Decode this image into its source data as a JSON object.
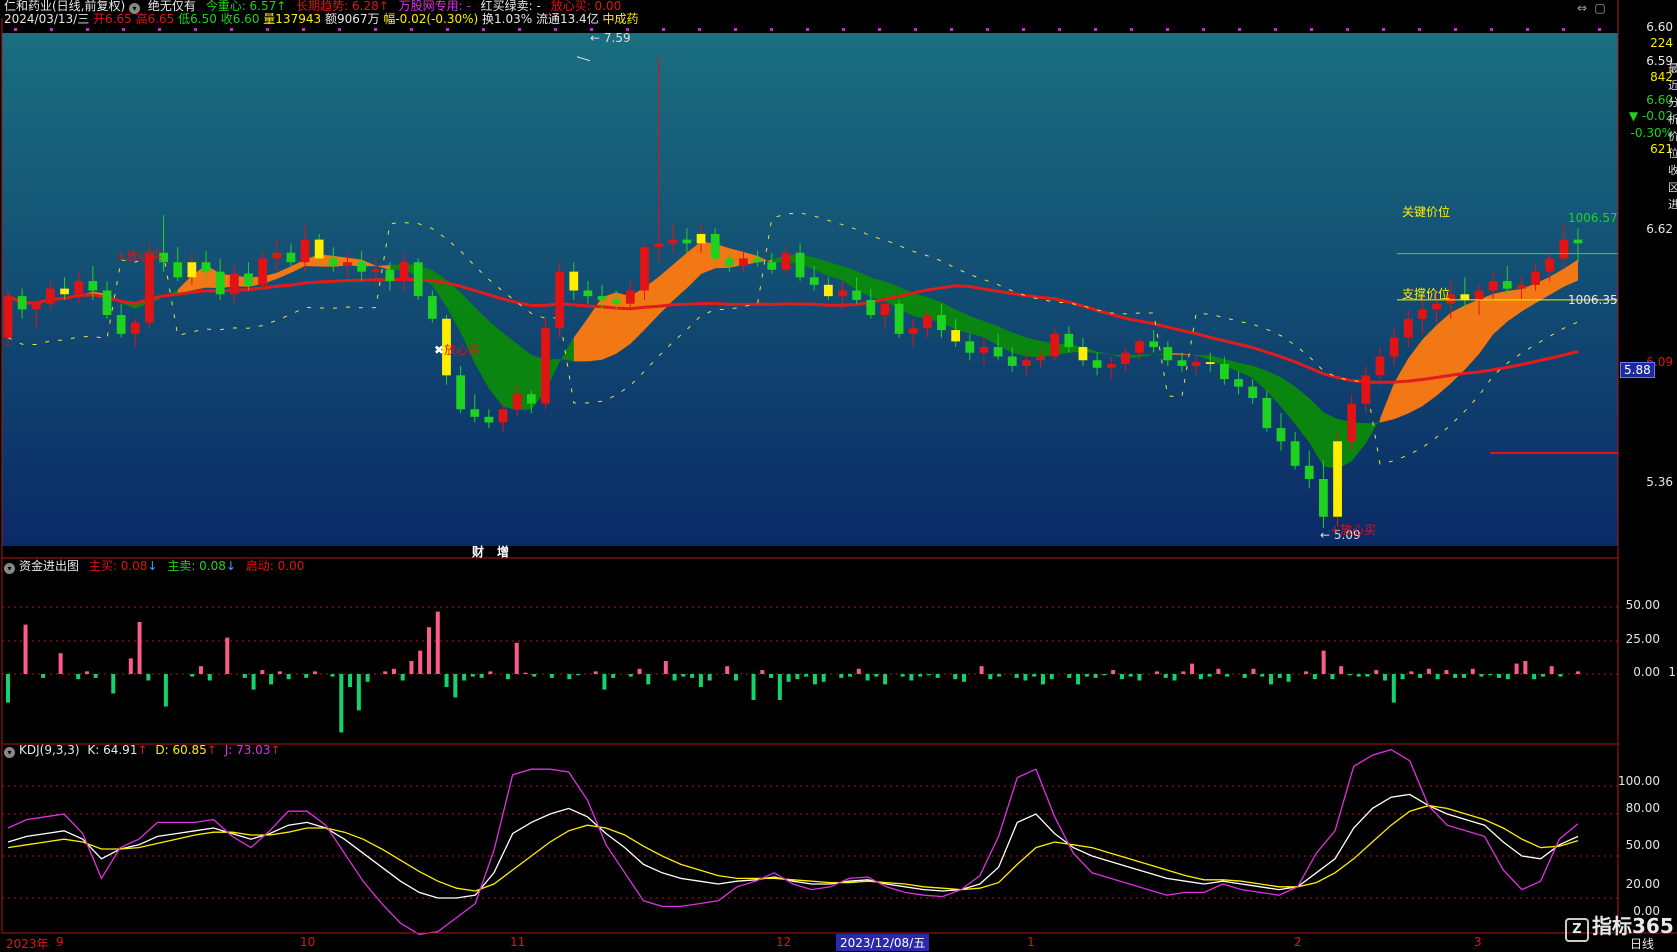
{
  "header": {
    "stock": "仁和药业(日线,前复权)",
    "indicator_name": "绝无仅有",
    "center_label": "今重心: 6.57",
    "center_arrow": "↑",
    "trend_label": "长期趋势: 6.28",
    "trend_arrow": "↑",
    "special_label": "万股网专用: -",
    "redgreen_label": "红买绿卖: -",
    "relief_label": "放心买: 0.00",
    "date": "2024/03/13/三",
    "open": "开6.65",
    "high": "高6.65",
    "low": "低6.50",
    "close": "收6.60",
    "volume": "量137943",
    "amount": "额9067万",
    "change": "幅-0.02(-0.30%)",
    "turnover": "换1.03%",
    "float": "流通13.4亿",
    "sector": "中成药"
  },
  "right_panel": {
    "price": "6.60",
    "vol1": "224",
    "price2": "6.59",
    "vol2": "842",
    "price3": "6.60",
    "change_arrow": "▼",
    "change": "-0.02",
    "change_pct": "-0.30%",
    "vol3": "621",
    "axis_labels": [
      "6.62",
      "6.09",
      "5.36"
    ],
    "price_tag": "5.88",
    "side_chars": [
      "最",
      "近",
      "分",
      "析",
      "价",
      "位",
      "收",
      "区",
      "进"
    ]
  },
  "main_panel": {
    "marks": {
      "high_label": "7.59",
      "low_label": "5.09",
      "key_price": "关键价位",
      "support_price": "支撑价位",
      "key_value": "1006.57",
      "support_value": "1006.35",
      "buy_signal": "放心买",
      "fin_tag1": "财",
      "fin_tag2": "增"
    }
  },
  "money_panel": {
    "title": "资金进出图",
    "main_buy": "主买: 0.08",
    "main_buy_arrow": "↓",
    "main_sell": "主卖: 0.08",
    "main_sell_arrow": "↓",
    "start": "启动: 0.00",
    "axis": [
      "50.00",
      "25.00",
      "0.00"
    ],
    "axis_suffix": "1"
  },
  "kdj_panel": {
    "title": "KDJ(9,3,3)",
    "k": "K: 64.91",
    "k_arrow": "↑",
    "d": "D: 60.85",
    "d_arrow": "↑",
    "j": "J: 73.03",
    "j_arrow": "↑",
    "axis": [
      "100.00",
      "80.00",
      "50.00",
      "20.00",
      "0.00"
    ]
  },
  "time_axis": {
    "labels": [
      "2023年",
      "9",
      "10",
      "11",
      "12",
      "2023/12/08/五",
      "1",
      "2",
      "3"
    ],
    "period": "日线"
  },
  "watermark": "指标365",
  "colors": {
    "up": "#e01414",
    "down": "#1fd21f",
    "orange_band": "#ff7a10",
    "green_band": "#0b8a0b",
    "trend_line": "#e31b1b",
    "kdj_k": "#ffffff",
    "kdj_d": "#ffee00",
    "kdj_j": "#e030e0"
  },
  "chart_data": [
    {
      "type": "candlestick",
      "title": "仁和药业(日线,前复权)",
      "note": "daily candles, Aug 2023 – Mar 2024",
      "ohlc": [
        [
          6.1,
          6.35,
          6.05,
          6.32
        ],
        [
          6.32,
          6.36,
          6.2,
          6.25
        ],
        [
          6.25,
          6.3,
          6.15,
          6.28
        ],
        [
          6.28,
          6.4,
          6.25,
          6.36
        ],
        [
          6.36,
          6.42,
          6.3,
          6.33
        ],
        [
          6.33,
          6.45,
          6.28,
          6.4
        ],
        [
          6.4,
          6.48,
          6.3,
          6.35
        ],
        [
          6.35,
          6.4,
          6.2,
          6.22
        ],
        [
          6.22,
          6.28,
          6.1,
          6.12
        ],
        [
          6.12,
          6.2,
          6.05,
          6.18
        ],
        [
          6.18,
          6.6,
          6.15,
          6.55
        ],
        [
          6.55,
          6.75,
          6.45,
          6.5
        ],
        [
          6.5,
          6.58,
          6.4,
          6.42
        ],
        [
          6.42,
          6.55,
          6.38,
          6.5
        ],
        [
          6.5,
          6.56,
          6.42,
          6.45
        ],
        [
          6.45,
          6.52,
          6.3,
          6.33
        ],
        [
          6.33,
          6.48,
          6.28,
          6.44
        ],
        [
          6.44,
          6.5,
          6.35,
          6.38
        ],
        [
          6.38,
          6.56,
          6.35,
          6.52
        ],
        [
          6.52,
          6.62,
          6.45,
          6.55
        ],
        [
          6.55,
          6.6,
          6.48,
          6.5
        ],
        [
          6.5,
          6.7,
          6.45,
          6.62
        ],
        [
          6.62,
          6.65,
          6.5,
          6.52
        ],
        [
          6.52,
          6.58,
          6.45,
          6.48
        ],
        [
          6.48,
          6.55,
          6.42,
          6.5
        ],
        [
          6.5,
          6.56,
          6.4,
          6.45
        ],
        [
          6.45,
          6.52,
          6.38,
          6.46
        ],
        [
          6.46,
          6.5,
          6.35,
          6.4
        ],
        [
          6.4,
          6.55,
          6.35,
          6.5
        ],
        [
          6.5,
          6.52,
          6.3,
          6.32
        ],
        [
          6.32,
          6.35,
          6.18,
          6.2
        ],
        [
          6.2,
          6.22,
          5.85,
          5.9
        ],
        [
          5.9,
          5.95,
          5.7,
          5.72
        ],
        [
          5.72,
          5.8,
          5.65,
          5.68
        ],
        [
          5.68,
          5.72,
          5.62,
          5.65
        ],
        [
          5.65,
          5.75,
          5.6,
          5.72
        ],
        [
          5.72,
          5.85,
          5.68,
          5.8
        ],
        [
          5.8,
          5.82,
          5.7,
          5.75
        ],
        [
          5.75,
          6.2,
          5.72,
          6.15
        ],
        [
          6.15,
          6.5,
          6.1,
          6.45
        ],
        [
          6.45,
          6.5,
          6.3,
          6.35
        ],
        [
          6.35,
          6.4,
          6.28,
          6.32
        ],
        [
          6.32,
          6.38,
          6.25,
          6.3
        ],
        [
          6.3,
          6.35,
          6.25,
          6.28
        ],
        [
          6.28,
          6.4,
          6.25,
          6.35
        ],
        [
          6.35,
          6.6,
          6.3,
          6.58
        ],
        [
          6.58,
          7.59,
          6.5,
          6.6
        ],
        [
          6.6,
          6.7,
          6.55,
          6.62
        ],
        [
          6.62,
          6.68,
          6.55,
          6.6
        ],
        [
          6.6,
          6.7,
          6.55,
          6.65
        ],
        [
          6.65,
          6.68,
          6.5,
          6.52
        ],
        [
          6.52,
          6.55,
          6.45,
          6.48
        ],
        [
          6.48,
          6.56,
          6.45,
          6.52
        ],
        [
          6.52,
          6.56,
          6.48,
          6.5
        ],
        [
          6.5,
          6.55,
          6.44,
          6.46
        ],
        [
          6.46,
          6.58,
          6.44,
          6.55
        ],
        [
          6.55,
          6.6,
          6.4,
          6.42
        ],
        [
          6.42,
          6.48,
          6.35,
          6.38
        ],
        [
          6.38,
          6.42,
          6.3,
          6.32
        ],
        [
          6.32,
          6.4,
          6.25,
          6.35
        ],
        [
          6.35,
          6.42,
          6.28,
          6.3
        ],
        [
          6.3,
          6.36,
          6.2,
          6.22
        ],
        [
          6.22,
          6.3,
          6.15,
          6.28
        ],
        [
          6.28,
          6.3,
          6.1,
          6.12
        ],
        [
          6.12,
          6.2,
          6.05,
          6.15
        ],
        [
          6.15,
          6.25,
          6.1,
          6.22
        ],
        [
          6.22,
          6.28,
          6.1,
          6.14
        ],
        [
          6.14,
          6.2,
          6.05,
          6.08
        ],
        [
          6.08,
          6.12,
          5.98,
          6.02
        ],
        [
          6.02,
          6.1,
          5.95,
          6.05
        ],
        [
          6.05,
          6.12,
          5.98,
          6.0
        ],
        [
          6.0,
          6.05,
          5.92,
          5.95
        ],
        [
          5.95,
          6.02,
          5.9,
          5.98
        ],
        [
          5.98,
          6.04,
          5.94,
          6.0
        ],
        [
          6.0,
          6.15,
          5.98,
          6.12
        ],
        [
          6.12,
          6.16,
          6.02,
          6.05
        ],
        [
          6.05,
          6.1,
          5.95,
          5.98
        ],
        [
          5.98,
          6.02,
          5.9,
          5.94
        ],
        [
          5.94,
          6.0,
          5.88,
          5.96
        ],
        [
          5.96,
          6.05,
          5.92,
          6.02
        ],
        [
          6.02,
          6.1,
          5.98,
          6.08
        ],
        [
          6.08,
          6.14,
          6.02,
          6.05
        ],
        [
          6.05,
          6.08,
          5.95,
          5.98
        ],
        [
          5.98,
          6.02,
          5.92,
          5.95
        ],
        [
          5.95,
          6.0,
          5.9,
          5.97
        ],
        [
          5.97,
          6.02,
          5.92,
          5.96
        ],
        [
          5.96,
          6.0,
          5.85,
          5.88
        ],
        [
          5.88,
          5.92,
          5.8,
          5.84
        ],
        [
          5.84,
          5.88,
          5.75,
          5.78
        ],
        [
          5.78,
          5.82,
          5.6,
          5.62
        ],
        [
          5.62,
          5.7,
          5.5,
          5.55
        ],
        [
          5.55,
          5.6,
          5.4,
          5.42
        ],
        [
          5.42,
          5.5,
          5.3,
          5.35
        ],
        [
          5.35,
          5.45,
          5.09,
          5.15
        ],
        [
          5.15,
          5.6,
          5.1,
          5.55
        ],
        [
          5.55,
          5.8,
          5.5,
          5.75
        ],
        [
          5.75,
          5.95,
          5.7,
          5.9
        ],
        [
          5.9,
          6.05,
          5.85,
          6.0
        ],
        [
          6.0,
          6.15,
          5.95,
          6.1
        ],
        [
          6.1,
          6.25,
          6.05,
          6.2
        ],
        [
          6.2,
          6.3,
          6.12,
          6.25
        ],
        [
          6.25,
          6.35,
          6.18,
          6.28
        ],
        [
          6.28,
          6.4,
          6.2,
          6.33
        ],
        [
          6.33,
          6.42,
          6.25,
          6.3
        ],
        [
          6.3,
          6.38,
          6.22,
          6.35
        ],
        [
          6.35,
          6.45,
          6.3,
          6.4
        ],
        [
          6.4,
          6.48,
          6.32,
          6.36
        ],
        [
          6.36,
          6.42,
          6.3,
          6.38
        ],
        [
          6.38,
          6.5,
          6.35,
          6.45
        ],
        [
          6.45,
          6.55,
          6.4,
          6.52
        ],
        [
          6.52,
          6.7,
          6.48,
          6.62
        ],
        [
          6.62,
          6.68,
          6.5,
          6.6
        ]
      ],
      "markers": {
        "high": 7.59,
        "low": 5.09,
        "key_price": 6.62,
        "support_price": 6.3
      }
    },
    {
      "type": "bar",
      "title": "资金进出图",
      "ylim": [
        -40,
        60
      ],
      "values": [
        -22,
        0,
        38,
        0,
        -3,
        0,
        16,
        0,
        -4,
        2,
        -3,
        0,
        -15,
        0,
        12,
        40,
        -5,
        0,
        -25,
        0,
        0,
        -2,
        6,
        -5,
        0,
        28,
        0,
        -3,
        -12,
        3,
        -8,
        2,
        -4,
        0,
        -3,
        2,
        0,
        -2,
        -45,
        -10,
        -28,
        -6,
        0,
        2,
        4,
        -5,
        10,
        18,
        36,
        48,
        -10,
        -18,
        -5,
        -2,
        -3,
        2,
        0,
        -4,
        24,
        1,
        -2,
        0,
        -3,
        0,
        -4,
        -1,
        0,
        2,
        -12,
        -3,
        0,
        -2,
        4,
        -8,
        0,
        10,
        -5,
        -2,
        -3,
        -10,
        -5,
        0,
        6,
        -5,
        0,
        -20,
        3,
        -3,
        -20,
        -6,
        -4,
        -2,
        -8,
        -6,
        0,
        -3,
        -2,
        4,
        -5,
        -2,
        -8,
        0,
        -2,
        -5,
        -2,
        -1,
        -3,
        0,
        -4,
        -6,
        0,
        6,
        -4,
        -2,
        0,
        -3,
        -5,
        -2,
        -8,
        -4,
        0,
        -3,
        -8,
        -2,
        -3,
        -1,
        3,
        -4,
        -2,
        -5,
        0,
        2,
        -3,
        -5,
        2,
        8,
        -4,
        -2,
        4,
        -2,
        0,
        -3,
        4,
        -2,
        -8,
        -3,
        -6,
        0,
        2,
        -4,
        18,
        -4,
        6,
        -1,
        -2,
        -2,
        3,
        -5,
        -22,
        -4,
        2,
        -3,
        4,
        -4,
        3,
        -3,
        -3,
        4,
        -2,
        -1,
        -3,
        -4,
        8,
        10,
        -4,
        -2,
        6,
        -2,
        0,
        2
      ]
    },
    {
      "type": "line",
      "title": "KDJ(9,3,3)",
      "ylim": [
        -10,
        120
      ],
      "series": [
        {
          "name": "K",
          "values": [
            60,
            64,
            66,
            68,
            62,
            48,
            55,
            58,
            64,
            66,
            68,
            70,
            66,
            62,
            66,
            72,
            74,
            70,
            62,
            52,
            42,
            32,
            24,
            20,
            20,
            22,
            38,
            66,
            74,
            80,
            84,
            78,
            66,
            56,
            44,
            38,
            34,
            32,
            30,
            32,
            33,
            35,
            32,
            30,
            30,
            32,
            33,
            30,
            28,
            26,
            25,
            26,
            30,
            42,
            74,
            80,
            66,
            56,
            50,
            46,
            42,
            38,
            34,
            32,
            30,
            32,
            30,
            28,
            26,
            28,
            38,
            48,
            70,
            84,
            92,
            94,
            86,
            80,
            76,
            72,
            60,
            50,
            48,
            58,
            64
          ]
        },
        {
          "name": "D",
          "values": [
            56,
            58,
            60,
            62,
            60,
            55,
            55,
            56,
            59,
            62,
            65,
            67,
            67,
            65,
            65,
            67,
            70,
            70,
            67,
            62,
            55,
            47,
            39,
            32,
            27,
            25,
            30,
            40,
            50,
            60,
            68,
            72,
            70,
            65,
            57,
            50,
            44,
            40,
            36,
            34,
            34,
            34,
            33,
            32,
            31,
            31,
            32,
            31,
            30,
            28,
            27,
            26,
            27,
            31,
            44,
            56,
            60,
            58,
            56,
            52,
            48,
            44,
            40,
            36,
            33,
            33,
            32,
            30,
            28,
            28,
            31,
            38,
            48,
            60,
            72,
            82,
            86,
            84,
            80,
            76,
            70,
            62,
            56,
            57,
            61
          ]
        },
        {
          "name": "J",
          "values": [
            70,
            76,
            78,
            80,
            66,
            34,
            56,
            62,
            74,
            74,
            74,
            76,
            64,
            56,
            68,
            82,
            82,
            72,
            52,
            32,
            16,
            2,
            -6,
            -4,
            6,
            16,
            54,
            108,
            112,
            112,
            110,
            90,
            58,
            38,
            18,
            14,
            14,
            16,
            18,
            28,
            32,
            38,
            30,
            26,
            28,
            34,
            35,
            28,
            24,
            22,
            21,
            26,
            36,
            64,
            106,
            112,
            78,
            52,
            38,
            34,
            30,
            26,
            22,
            24,
            24,
            30,
            26,
            24,
            22,
            28,
            52,
            68,
            114,
            122,
            126,
            118,
            86,
            72,
            68,
            64,
            40,
            26,
            32,
            62,
            73
          ]
        }
      ]
    }
  ]
}
